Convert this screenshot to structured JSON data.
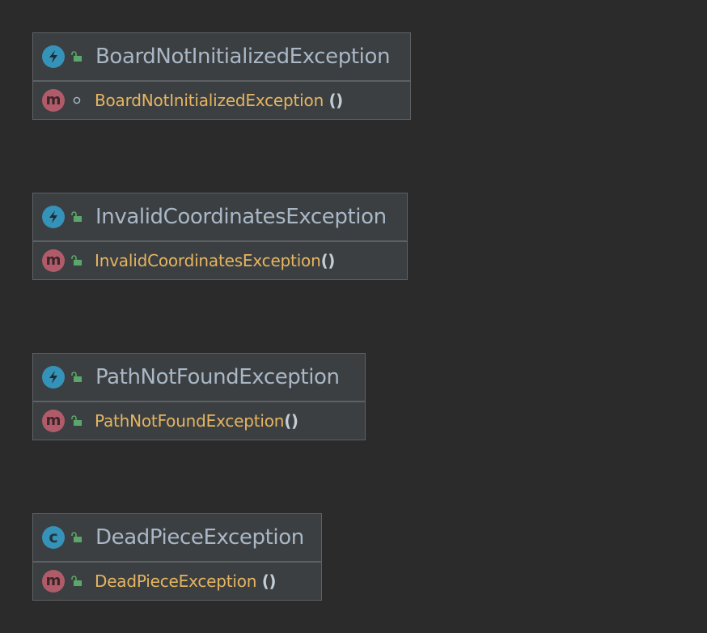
{
  "diagram": {
    "classes": [
      {
        "name": "BoardNotInitializedException",
        "kind_icon": "exception-bolt-icon",
        "visibility_icon": "public-lock-icon",
        "methods": [
          {
            "name": "BoardNotInitializedException",
            "parens": " ()",
            "kind_icon": "method-m-icon",
            "visibility_icon": "package-private-dot-icon"
          }
        ]
      },
      {
        "name": "InvalidCoordinatesException",
        "kind_icon": "exception-bolt-icon",
        "visibility_icon": "public-lock-icon",
        "methods": [
          {
            "name": "InvalidCoordinatesException",
            "parens": "()",
            "kind_icon": "method-m-icon",
            "visibility_icon": "public-lock-icon"
          }
        ]
      },
      {
        "name": "PathNotFoundException",
        "kind_icon": "exception-bolt-icon",
        "visibility_icon": "public-lock-icon",
        "methods": [
          {
            "name": "PathNotFoundException",
            "parens": "()",
            "kind_icon": "method-m-icon",
            "visibility_icon": "public-lock-icon"
          }
        ]
      },
      {
        "name": "DeadPieceException",
        "kind_icon": "class-c-icon",
        "kind_letter": "c",
        "visibility_icon": "public-lock-icon",
        "methods": [
          {
            "name": "DeadPieceException",
            "parens": " ()",
            "kind_icon": "method-m-icon",
            "visibility_icon": "public-lock-icon"
          }
        ]
      }
    ],
    "method_letter": "m",
    "colors": {
      "background": "#2b2b2b",
      "box": "#3c3f41",
      "border": "#5e6164",
      "class_name": "#a9b7c6",
      "method_name": "#e5b561",
      "exception_icon": "#3592b8",
      "method_icon": "#b05b6a",
      "lock_icon": "#59a869"
    }
  }
}
